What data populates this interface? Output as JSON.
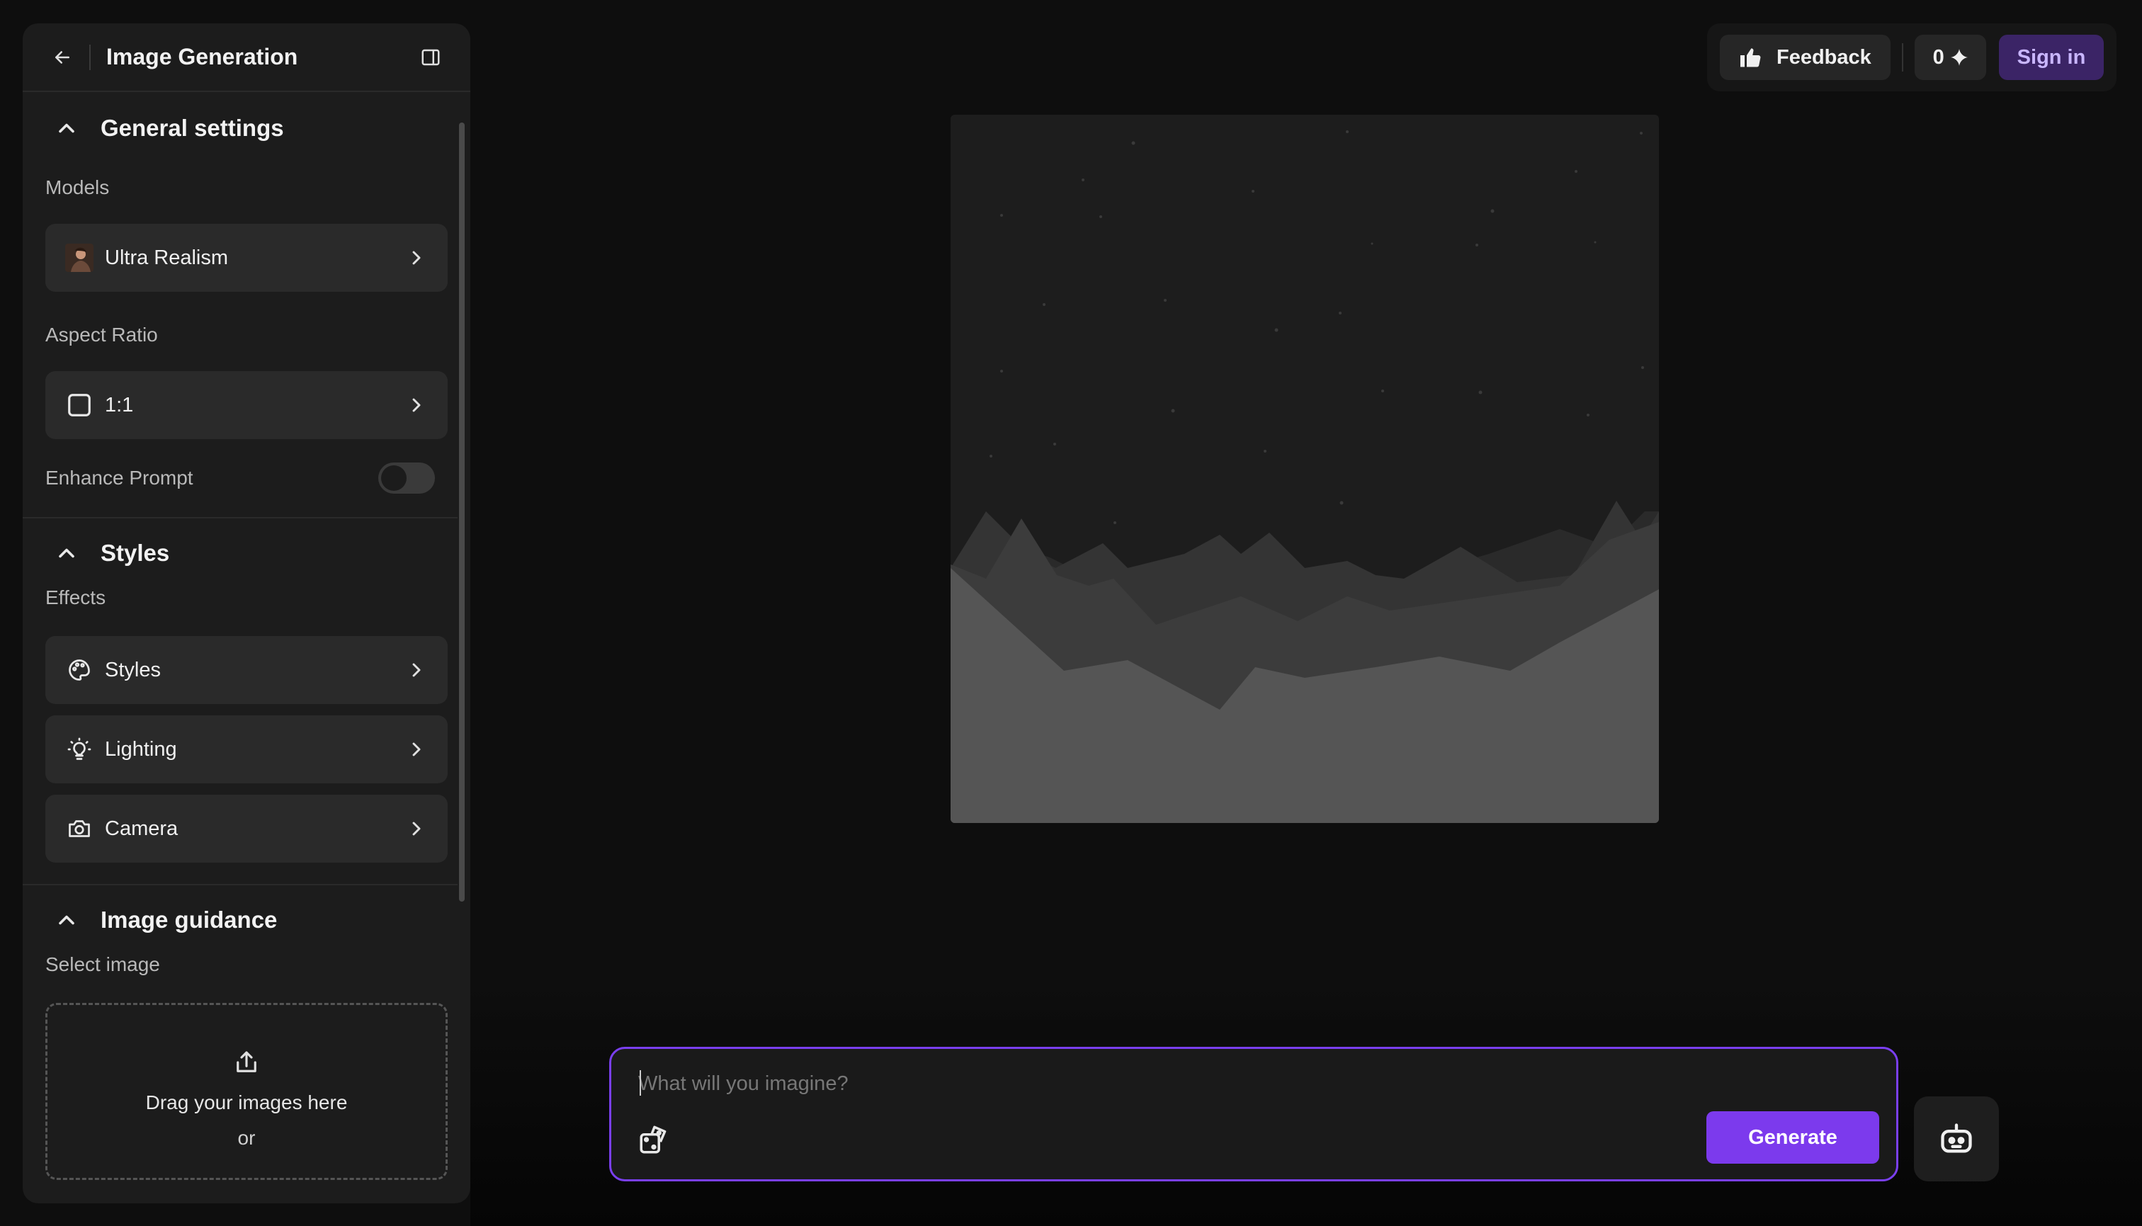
{
  "sidebar": {
    "title": "Image Generation",
    "general": {
      "title": "General settings",
      "models_label": "Models",
      "model_value": "Ultra Realism",
      "aspect_label": "Aspect Ratio",
      "aspect_value": "1:1",
      "enhance_label": "Enhance Prompt",
      "enhance_on": false
    },
    "styles": {
      "title": "Styles",
      "effects_label": "Effects",
      "items": [
        "Styles",
        "Lighting",
        "Camera"
      ]
    },
    "guidance": {
      "title": "Image guidance",
      "select_label": "Select image",
      "drop_text": "Drag your images here",
      "or_text": "or"
    }
  },
  "topbar": {
    "feedback_label": "Feedback",
    "credits": "0",
    "signin_label": "Sign in"
  },
  "prompt": {
    "placeholder": "What will you imagine?",
    "generate_label": "Generate"
  },
  "colors": {
    "accent": "#7c3aed",
    "signin_bg": "#3b2466",
    "background": "#0e0e0e",
    "panel": "#1c1c1c"
  },
  "icons": [
    "back-arrow-icon",
    "sidebar-toggle-icon",
    "chevron-up-icon",
    "chevron-right-icon",
    "square-icon",
    "palette-icon",
    "lightbulb-icon",
    "camera-icon",
    "upload-icon",
    "thumbs-up-icon",
    "sparkle-icon",
    "dice-icon",
    "robot-icon"
  ]
}
